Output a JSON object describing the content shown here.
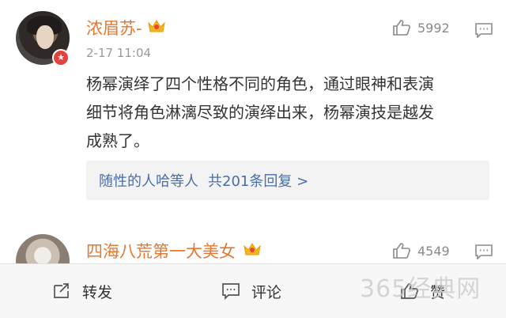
{
  "comments": [
    {
      "username": "浓眉苏-",
      "timestamp": "2-17 11:04",
      "likes": "5992",
      "body_line1": "杨幂演绎了四个性格不同的角色，通过眼神和表演",
      "body_line2": "细节将角色淋漓尽致的演绎出来，杨幂演技是越发",
      "body_line3": "成熟了。",
      "replies_user": "随性的人哈等人",
      "replies_count": "共201条回复 >"
    },
    {
      "username": "四海八荒第一大美女",
      "likes": "4549"
    }
  ],
  "bottom_bar": {
    "repost": "转发",
    "comment": "评论",
    "like": "赞"
  },
  "watermark": "365经典网",
  "colors": {
    "username": "#e8772e",
    "link": "#4a6ea8",
    "muted": "#9a9a9a"
  }
}
